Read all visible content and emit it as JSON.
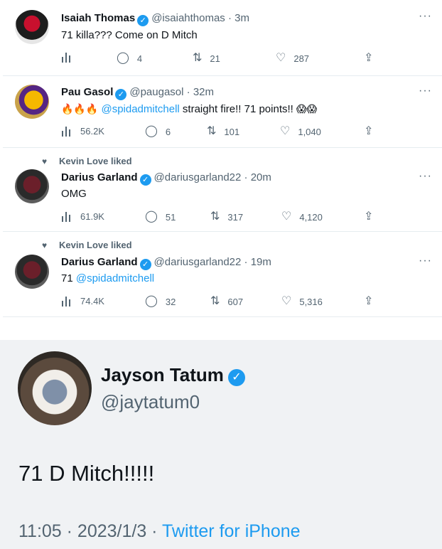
{
  "tweets": [
    {
      "name": "Isaiah Thomas",
      "handle": "@isaiahthomas",
      "time": "· 3m",
      "text": "71 killa??? Come on D Mitch",
      "views": "",
      "replies": "4",
      "retweets": "21",
      "likes": "287",
      "more_icon": "more-horizontal-icon"
    },
    {
      "name": "Pau Gasol",
      "handle": "@paugasol",
      "time": "· 32m",
      "text_prefix_emoji": "🔥🔥🔥",
      "mention": "@spidadmitchell",
      "text": " straight fire!! 71 points!! ",
      "text_suffix_emoji": "😱😱",
      "views": "56.2K",
      "replies": "6",
      "retweets": "101",
      "likes": "1,040"
    },
    {
      "liked_by": "Kevin Love liked",
      "name": "Darius Garland",
      "handle": "@dariusgarland22",
      "time": "· 20m",
      "text": "OMG",
      "views": "61.9K",
      "replies": "51",
      "retweets": "317",
      "likes": "4,120"
    },
    {
      "liked_by": "Kevin Love liked",
      "name": "Darius Garland",
      "handle": "@dariusgarland22",
      "time": "· 19m",
      "text": "71 ",
      "mention": "@spidadmitchell",
      "views": "74.4K",
      "replies": "32",
      "retweets": "607",
      "likes": "5,316"
    }
  ],
  "tatum": {
    "name": "Jayson Tatum",
    "handle": "@jaytatum0",
    "text": "71 D Mitch!!!!!",
    "time_date": "11:05 · 2023/1/3 · ",
    "source": "Twitter for iPhone"
  },
  "icons": {
    "views": "stats-icon",
    "reply": "reply-icon",
    "retweet": "retweet-icon",
    "like": "heart-icon",
    "share": "share-icon",
    "verified": "verified-badge-icon"
  },
  "colors": {
    "accent": "#1d9bf0",
    "muted": "#536471",
    "text": "#0f1419"
  }
}
